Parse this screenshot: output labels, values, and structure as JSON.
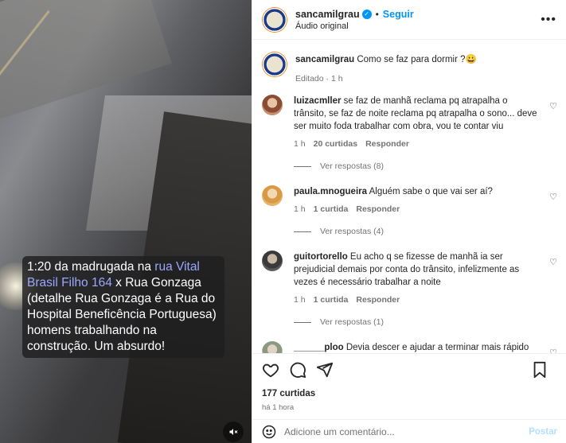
{
  "video": {
    "caption_prefix": "1:20 da madrugada na ",
    "caption_link": "rua Vital Brasil Filho 164",
    "caption_suffix": " x Rua Gonzaga (detalhe Rua Gonzaga é a Rua do Hospital Beneficência Portuguesa) homens trabalhando na construção. Um absurdo!",
    "mute_icon": "speaker-muted-icon"
  },
  "header": {
    "username": "sancamilgrau",
    "separator": "•",
    "follow_label": "Seguir",
    "audio_label": "Áudio original",
    "more_icon": "more-horizontal-icon"
  },
  "post": {
    "username": "sancamilgrau",
    "caption": "Como se faz para dormir ?😀",
    "edited": "Editado · 1 h"
  },
  "comments": [
    {
      "username": "luizacmller",
      "text": "se faz de manhã reclama pq atrapalha o trânsito, se faz de noite reclama pq atrapalha o sono... deve ser muito foda trabalhar com obra, vou te contar viu",
      "time": "1 h",
      "likes": "20 curtidas",
      "reply": "Responder",
      "view_replies": "Ver respostas (8)",
      "avatar_color": "#c98f6d"
    },
    {
      "username": "paula.mnogueira",
      "text": "Alguém sabe o que vai ser aí?",
      "time": "1 h",
      "likes": "1 curtida",
      "reply": "Responder",
      "view_replies": "Ver respostas (4)",
      "avatar_color": "#e5b36a"
    },
    {
      "username": "guitortorello",
      "text": "Eu acho q se fizesse de manhã ia ser prejudicial demais por conta do trânsito, infelizmente as vezes é necessário trabalhar a noite",
      "time": "1 h",
      "likes": "1 curtida",
      "reply": "Responder",
      "view_replies": "Ver respostas (1)",
      "avatar_color": "#5a5a5a"
    },
    {
      "username": "______ploo",
      "text": "Devia descer e ajudar a terminar mais rápido 😂😂",
      "avatar_color": "#b9c5b0"
    }
  ],
  "actions": {
    "likes": "177 curtidas",
    "time": "há 1 hora"
  },
  "composer": {
    "placeholder": "Adicione um comentário...",
    "post_label": "Postar",
    "emoji_icon": "emoji-icon"
  },
  "colors": {
    "accent": "#0095f6",
    "post_disabled": "#b2dffc",
    "caption_link": "#9aa8ff"
  }
}
